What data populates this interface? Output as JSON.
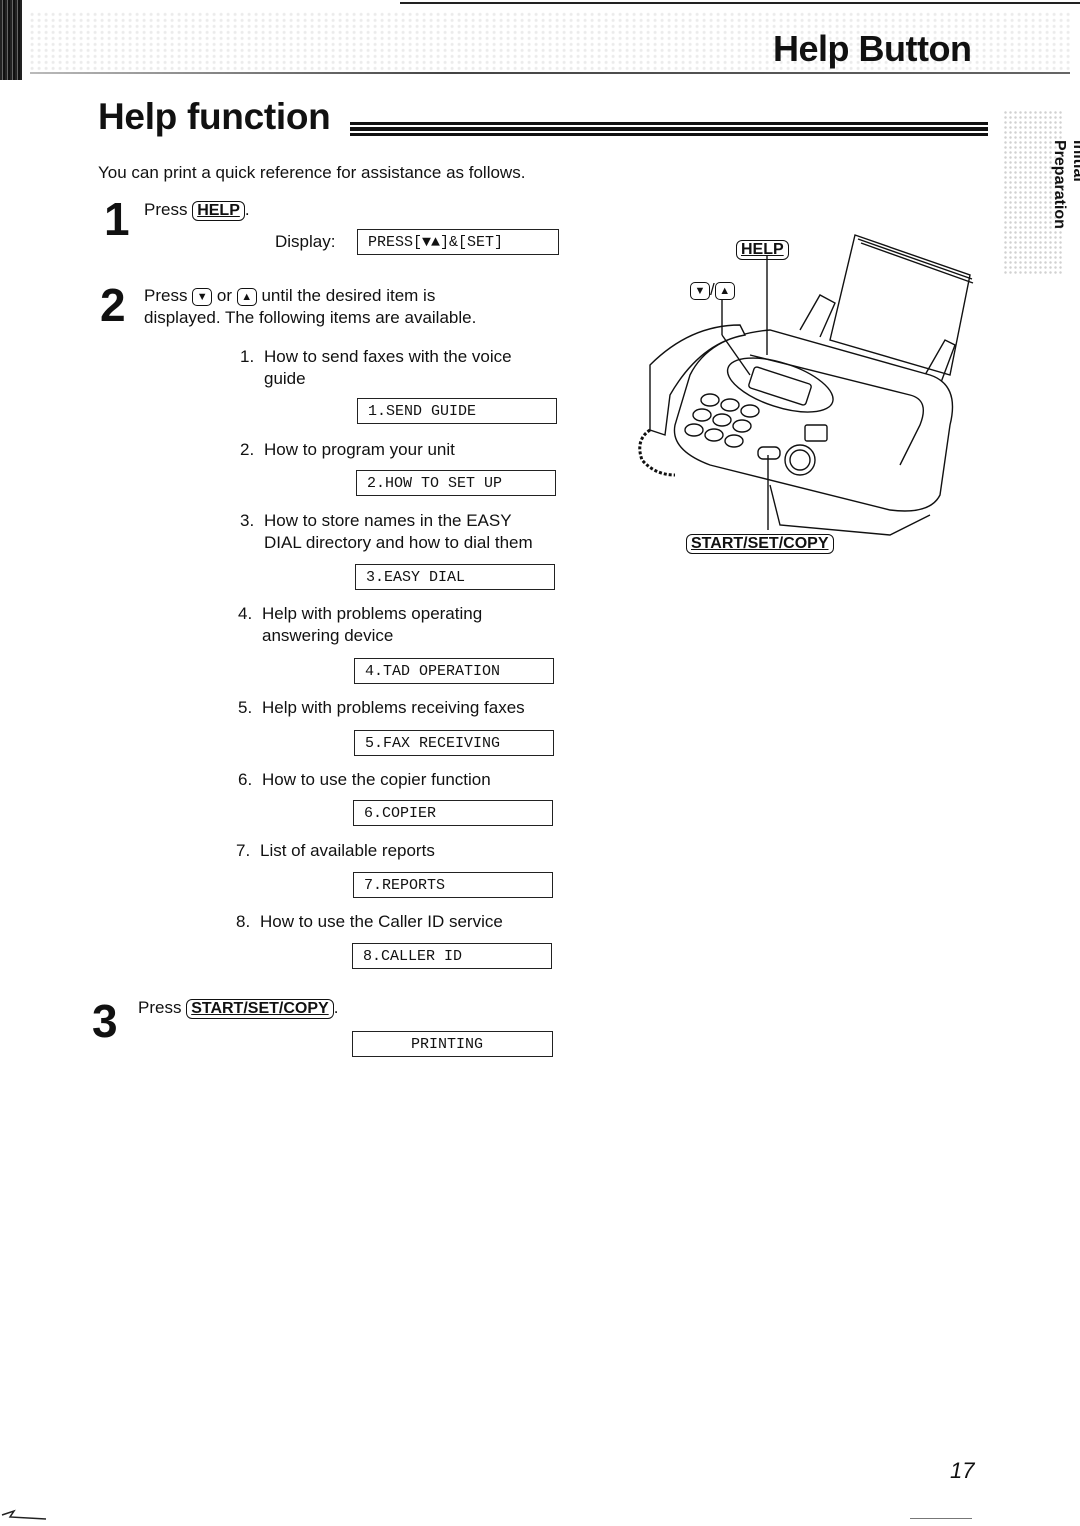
{
  "header": {
    "section_title": "Help Button",
    "side_tab": {
      "line1": "Initial",
      "line2": "Preparation"
    }
  },
  "page_title": "Help function",
  "intro": "You can print a quick reference for assistance as follows.",
  "steps": [
    {
      "number": "1",
      "text_before": "Press ",
      "key": "HELP",
      "text_after": ".",
      "display_label": "Display:",
      "display": "PRESS[▼▲]&[SET]"
    },
    {
      "number": "2",
      "text_press": "Press ",
      "key_down": "▼",
      "text_or": " or ",
      "key_up": "▲",
      "text_rest": " until the desired item is",
      "text_line2": "displayed. The following items are available.",
      "items": [
        {
          "num": "1.",
          "line1": "How to send faxes with the voice",
          "line2": "guide",
          "display": "1.SEND GUIDE"
        },
        {
          "num": "2.",
          "line1": "How to program your unit",
          "line2": "",
          "display": "2.HOW TO SET UP"
        },
        {
          "num": "3.",
          "line1": "How to store names in the EASY",
          "line2": "DIAL directory and how to dial them",
          "display": "3.EASY DIAL"
        },
        {
          "num": "4.",
          "line1": "Help with problems operating",
          "line2": "answering device",
          "display": "4.TAD OPERATION"
        },
        {
          "num": "5.",
          "line1": "Help with problems receiving faxes",
          "line2": "",
          "display": "5.FAX RECEIVING"
        },
        {
          "num": "6.",
          "line1": "How to use the copier function",
          "line2": "",
          "display": "6.COPIER"
        },
        {
          "num": "7.",
          "line1": "List of available reports",
          "line2": "",
          "display": "7.REPORTS"
        },
        {
          "num": "8.",
          "line1": "How to use the Caller ID service",
          "line2": "",
          "display": "8.CALLER ID"
        }
      ]
    },
    {
      "number": "3",
      "text_before": "Press ",
      "key": "START/SET/COPY",
      "text_after": ".",
      "display": "PRINTING"
    }
  ],
  "illustration": {
    "label_help": "HELP",
    "label_arrows_down": "▼",
    "label_arrows_sep": "/",
    "label_arrows_up": "▲",
    "label_start": "START/SET/COPY"
  },
  "page_number": "17"
}
